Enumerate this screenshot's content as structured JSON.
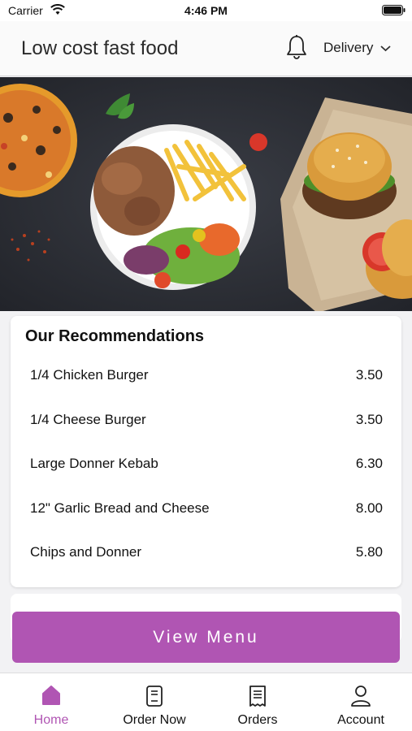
{
  "status_bar": {
    "carrier": "Carrier",
    "time": "4:46 PM"
  },
  "header": {
    "title": "Low cost fast food",
    "notification_icon": "bell-icon",
    "delivery_label": "Delivery",
    "dropdown_icon": "chevron-down-icon"
  },
  "hero": {
    "description_icon": "food-banner-image"
  },
  "recommendations": {
    "title": "Our Recommendations",
    "items": [
      {
        "name": "1/4 Chicken Burger",
        "price": "3.50"
      },
      {
        "name": "1/4 Cheese Burger",
        "price": "3.50"
      },
      {
        "name": "Large Donner Kebab",
        "price": "6.30"
      },
      {
        "name": "12\" Garlic Bread and Cheese",
        "price": "8.00"
      },
      {
        "name": "Chips and Donner",
        "price": "5.80"
      }
    ]
  },
  "view_menu_label": "View Menu",
  "tabs": [
    {
      "label": "Home",
      "icon": "home-icon",
      "active": true
    },
    {
      "label": "Order Now",
      "icon": "order-icon",
      "active": false
    },
    {
      "label": "Orders",
      "icon": "receipt-icon",
      "active": false
    },
    {
      "label": "Account",
      "icon": "user-icon",
      "active": false
    }
  ],
  "colors": {
    "accent": "#b055b3",
    "background": "#f2f2f4"
  }
}
